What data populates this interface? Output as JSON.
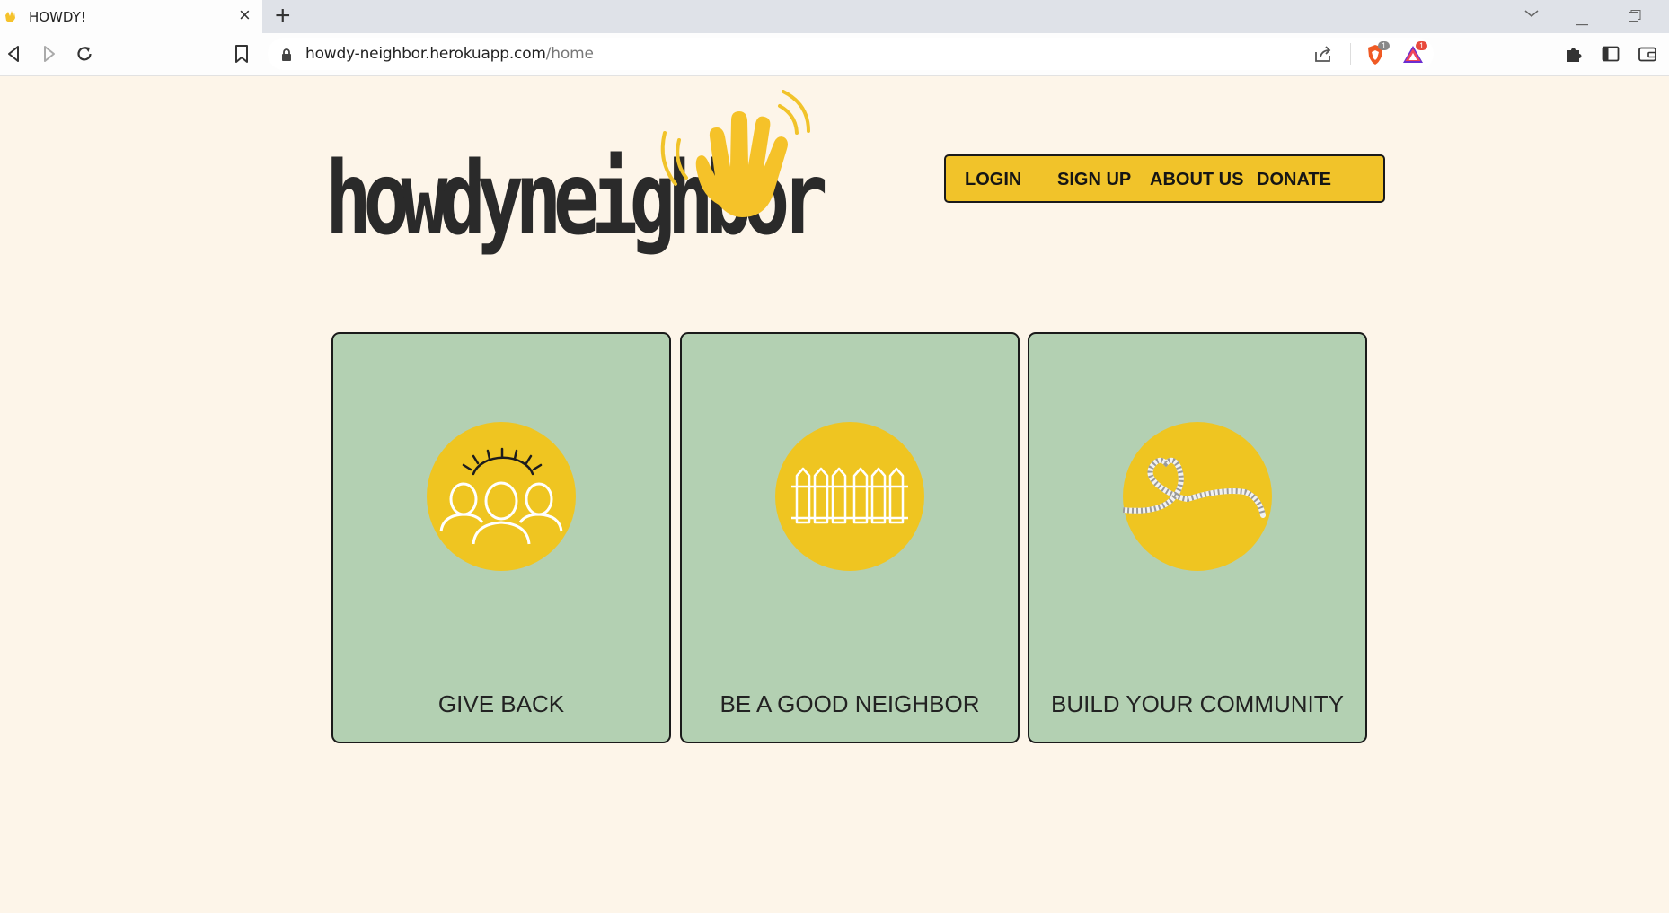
{
  "browser": {
    "tab_title": "HOWDY!",
    "url_host": "howdy-neighbor.herokuapp.com",
    "url_path": "/home",
    "brave_shield_count": "1",
    "rewards_count": "1"
  },
  "header": {
    "logo_text": "howdyneighbor",
    "nav": [
      {
        "label": "LOGIN"
      },
      {
        "label": "SIGN UP"
      },
      {
        "label": "ABOUT US"
      },
      {
        "label": "DONATE"
      }
    ]
  },
  "cards": [
    {
      "label": "GIVE BACK",
      "icon": "people-sunrise-icon"
    },
    {
      "label": "BE A GOOD NEIGHBOR",
      "icon": "picket-fence-icon"
    },
    {
      "label": "BUILD YOUR COMMUNITY",
      "icon": "rope-heart-icon"
    }
  ],
  "colors": {
    "page_bg": "#fdf5e9",
    "accent_yellow": "#f1c32a",
    "card_green": "#b3d0b2",
    "text_dark": "#222222"
  }
}
